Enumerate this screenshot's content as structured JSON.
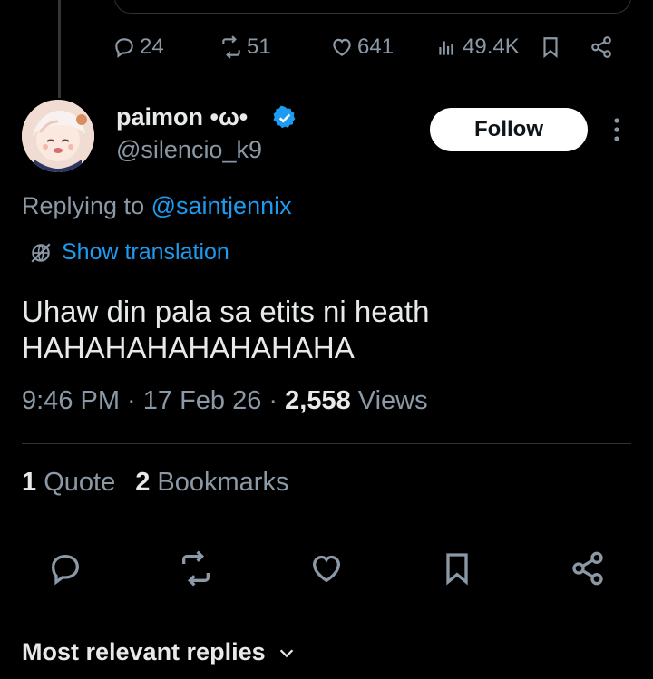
{
  "top_actions": {
    "replies": "24",
    "reposts": "51",
    "likes": "641",
    "views": "49.4K"
  },
  "author": {
    "name": "paimon •ω•",
    "handle": "@silencio_k9",
    "follow_label": "Follow"
  },
  "reply_context": {
    "prefix": "Replying to",
    "mention": "@saintjennix"
  },
  "translation_label": "Show translation",
  "tweet": {
    "line1": "Uhaw din pala sa etits ni heath",
    "line2": "HAHAHAHAHAHAHAHA"
  },
  "meta": {
    "time_date": "9:46 PM · 17 Feb 26 · ",
    "views_count": "2,558",
    "views_label": "Views"
  },
  "stats": {
    "quotes_count": "1",
    "quotes_label": "Quote",
    "bookmarks_count": "2",
    "bookmarks_label": "Bookmarks"
  },
  "replies_sort_label": "Most relevant replies",
  "colors": {
    "accent": "#1d9bf0",
    "muted": "#8b98a5",
    "text": "#e7e9ea",
    "background": "#000000"
  }
}
